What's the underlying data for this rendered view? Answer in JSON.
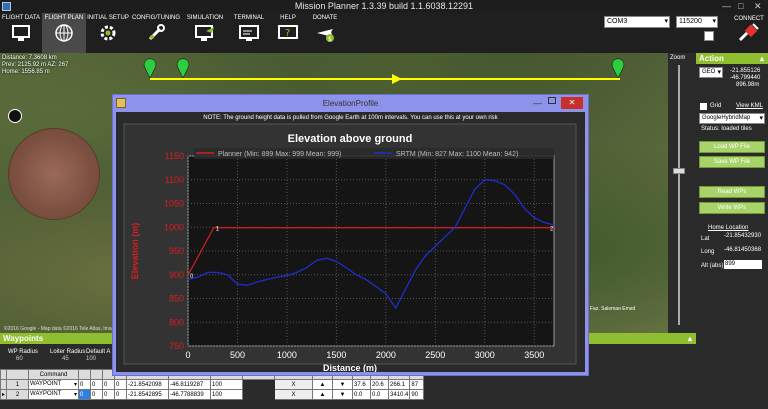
{
  "window": {
    "title": "Mission Planner 1.3.39 build 1.1.6038.12291"
  },
  "menu": [
    {
      "label": "FLIGHT DATA",
      "icon": "monitor-icon"
    },
    {
      "label": "FLIGHT PLAN",
      "icon": "globe-icon"
    },
    {
      "label": "INITIAL SETUP",
      "icon": "gear-icon"
    },
    {
      "label": "CONFIG/TUNING",
      "icon": "wrench-icon"
    },
    {
      "label": "SIMULATION",
      "icon": "monitor-plane-icon"
    },
    {
      "label": "TERMINAL",
      "icon": "terminal-icon"
    },
    {
      "label": "HELP",
      "icon": "help-icon"
    },
    {
      "label": "DONATE",
      "icon": "plane-dollar-icon"
    }
  ],
  "connection": {
    "port": "COM3",
    "baud": "115200",
    "connect_label": "CONNECT"
  },
  "map": {
    "distance": "Distance: 7.3608 km",
    "prev": "Prev: 2125.92 m AZ: 267",
    "home": "Home: 1556.85 m",
    "copyright": "©2016 Google - Map data ©2016 Tele Atlas, Imagery ©2016 TerraMetrics",
    "place_label": "Faz. Salomao Emed"
  },
  "zoom": {
    "label": "Zoom"
  },
  "action_panel": {
    "title": "Action",
    "frame": "GEO",
    "lat": "-21.855126",
    "lng": "-46.799440",
    "alt": "896.98m",
    "grid_label": "Grid",
    "view_kml": "View KML",
    "map_type": "GoogleHybridMap",
    "status": "Status: loaded tiles",
    "load_wp": "Load WP File",
    "save_wp": "Save WP File",
    "read_wps": "Read WPs",
    "write_wps": "Write WPs",
    "home_location": "Home Location",
    "home_lat_label": "Lat",
    "home_lat": "-21.85432930",
    "home_long_label": "Long",
    "home_long": "-46.81450368",
    "home_alt_label": "Alt (abs)",
    "home_alt": "899"
  },
  "waypoints": {
    "title": "Waypoints",
    "wp_radius_label": "WP Radius",
    "wp_radius": "60",
    "loiter_radius_label": "Loiter Radius",
    "loiter_radius": "45",
    "default_alt_label": "Default A",
    "default_alt": "100",
    "columns": [
      "",
      "Command",
      "",
      "",
      "",
      "",
      "",
      "",
      "",
      "",
      "",
      "",
      "",
      "",
      "",
      ""
    ],
    "rows": [
      {
        "num": "1",
        "command": "WAYPOINT",
        "p1": "0",
        "p2": "0",
        "p3": "0",
        "p4": "0",
        "lat": "-21.8542098",
        "lon": "-46.8119287",
        "alt": "100",
        "delete": "X",
        "grad": "37.6",
        "angle": "20.6",
        "dist": "266.1",
        "az": "87"
      },
      {
        "num": "2",
        "command": "WAYPOINT",
        "p1": "0",
        "p2": "0",
        "p3": "0",
        "p4": "0",
        "lat": "-21.8542895",
        "lon": "-46.7788839",
        "alt": "100",
        "delete": "X",
        "grad": "0.0",
        "angle": "0.0",
        "dist": "3410.4",
        "az": "90"
      }
    ]
  },
  "dialog": {
    "title": "ElevationProfile",
    "note": "NOTE: The ground height data is pulled from Google Earth at 100m intervals. You can use this at your own risk"
  },
  "chart_data": {
    "type": "line",
    "title": "Elevation above ground",
    "xlabel": "Distance (m)",
    "ylabel": "Elevation (m)",
    "xlim": [
      0,
      3700
    ],
    "ylim": [
      750,
      1150
    ],
    "xticks": [
      0,
      500,
      1000,
      1500,
      2000,
      2500,
      3000,
      3500
    ],
    "yticks": [
      750,
      800,
      850,
      900,
      950,
      1000,
      1050,
      1100,
      1150
    ],
    "grid": true,
    "legend_position": "top",
    "series": [
      {
        "name": "Planner (Min: 899 Max: 999 Mean: 999)",
        "color": "#d81e1e",
        "x": [
          0,
          260,
          3700
        ],
        "y": [
          899,
          999,
          999
        ]
      },
      {
        "name": "SRTM (Min: 827 Max: 1100 Mean: 942)",
        "color": "#1f2ecc",
        "x": [
          0,
          100,
          200,
          300,
          400,
          500,
          600,
          700,
          800,
          900,
          1000,
          1100,
          1200,
          1300,
          1400,
          1500,
          1600,
          1700,
          1800,
          1900,
          2000,
          2100,
          2200,
          2300,
          2400,
          2500,
          2600,
          2700,
          2800,
          2900,
          3000,
          3100,
          3200,
          3300,
          3400,
          3500,
          3600,
          3700
        ],
        "y": [
          890,
          895,
          905,
          905,
          900,
          880,
          878,
          885,
          890,
          895,
          898,
          905,
          915,
          930,
          935,
          928,
          915,
          900,
          890,
          875,
          860,
          830,
          870,
          910,
          940,
          960,
          980,
          1000,
          1040,
          1080,
          1100,
          1098,
          1090,
          1070,
          1040,
          1020,
          1010,
          1005
        ]
      }
    ],
    "annotations": [
      {
        "text": "0",
        "x": 0,
        "y": 899
      },
      {
        "text": "1",
        "x": 260,
        "y": 999
      },
      {
        "text": "2",
        "x": 3700,
        "y": 999
      }
    ]
  }
}
